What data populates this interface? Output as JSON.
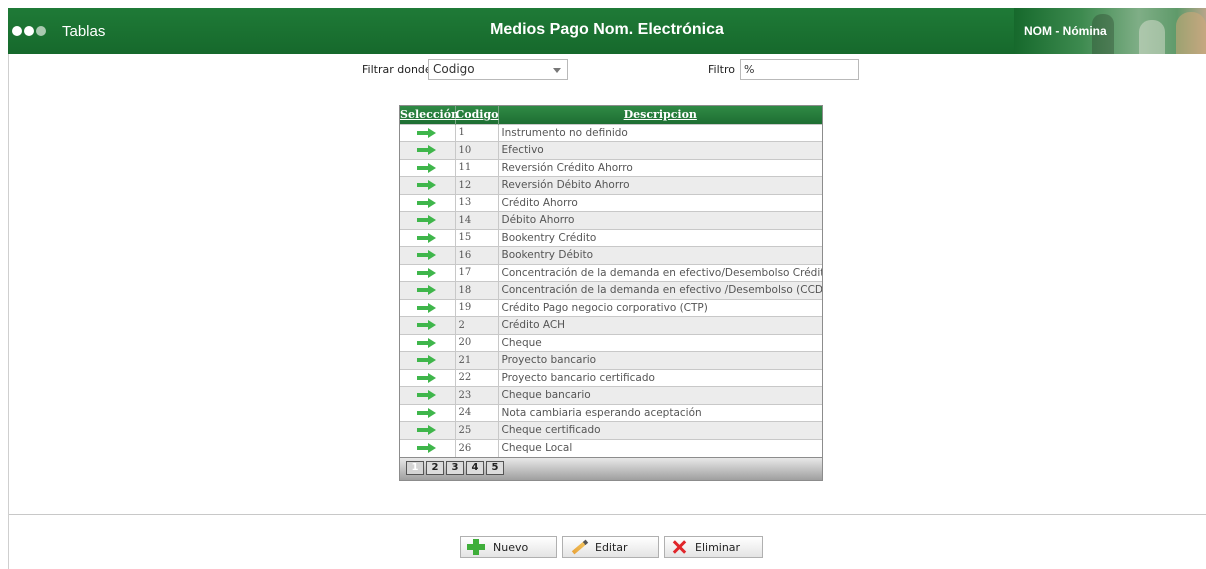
{
  "header": {
    "app_title": "Tablas",
    "page_title": "Medios Pago Nom. Electrónica",
    "module": "NOM - Nómina"
  },
  "filter": {
    "where_label": "Filtrar donde",
    "field_value": "Codigo",
    "filter_label": "Filtro",
    "filter_value": "%"
  },
  "grid": {
    "columns": [
      "Selección",
      "Codigo",
      "Descripcion"
    ],
    "rows": [
      {
        "code": "1",
        "desc": "Instrumento no definido"
      },
      {
        "code": "10",
        "desc": "Efectivo"
      },
      {
        "code": "11",
        "desc": "Reversión Crédito Ahorro"
      },
      {
        "code": "12",
        "desc": "Reversión Débito Ahorro"
      },
      {
        "code": "13",
        "desc": "Crédito Ahorro"
      },
      {
        "code": "14",
        "desc": "Débito Ahorro"
      },
      {
        "code": "15",
        "desc": "Bookentry Crédito"
      },
      {
        "code": "16",
        "desc": "Bookentry Débito"
      },
      {
        "code": "17",
        "desc": "Concentración de la demanda en efectivo/Desembolso Crédito (CCD)"
      },
      {
        "code": "18",
        "desc": "Concentración de la demanda en efectivo /Desembolso (CCD) débito"
      },
      {
        "code": "19",
        "desc": "Crédito Pago negocio corporativo (CTP)"
      },
      {
        "code": "2",
        "desc": "Crédito ACH"
      },
      {
        "code": "20",
        "desc": "Cheque"
      },
      {
        "code": "21",
        "desc": "Proyecto bancario"
      },
      {
        "code": "22",
        "desc": "Proyecto bancario certificado"
      },
      {
        "code": "23",
        "desc": "Cheque bancario"
      },
      {
        "code": "24",
        "desc": "Nota cambiaria esperando aceptación"
      },
      {
        "code": "25",
        "desc": "Cheque certificado"
      },
      {
        "code": "26",
        "desc": "Cheque Local"
      }
    ],
    "pages": [
      "1",
      "2",
      "3",
      "4",
      "5"
    ],
    "current_page": "1"
  },
  "actions": {
    "new": "Nuevo",
    "edit": "Editar",
    "delete": "Eliminar"
  },
  "colors": {
    "header_green": "#1f7a37",
    "arrow_green": "#3fb64b"
  }
}
